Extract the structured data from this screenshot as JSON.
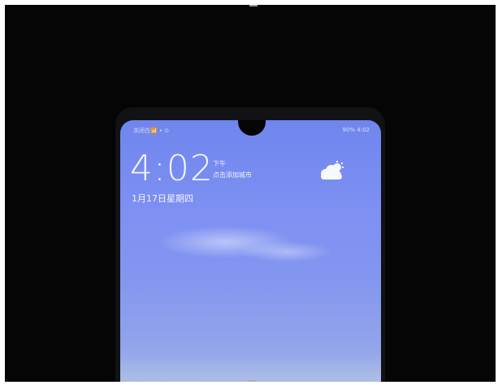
{
  "status_bar": {
    "left_text": "关闭白📶 • ⊙",
    "right_text": "90%  4:02"
  },
  "lockscreen": {
    "time": "4:02",
    "ampm": "下午",
    "location": "点击添加城市",
    "date": "1月17日星期四"
  },
  "icons": {
    "weather": "partly-cloudy-icon"
  },
  "colors": {
    "screen_top": "#6f86ee",
    "screen_bottom": "#a4b5e6",
    "background": "#050506"
  }
}
